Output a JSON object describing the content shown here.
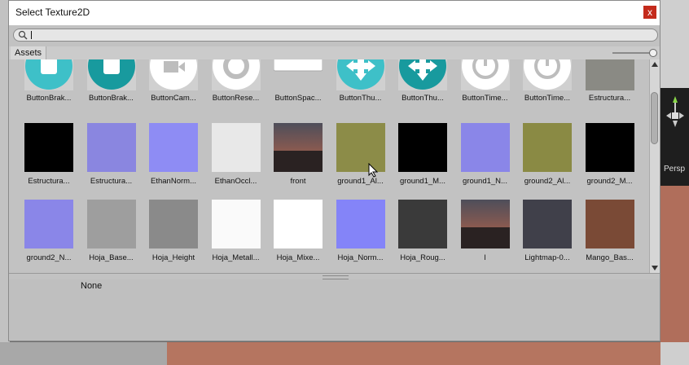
{
  "dialog": {
    "title": "Select Texture2D",
    "close_label": "x"
  },
  "search": {
    "value": "",
    "placeholder": ""
  },
  "tabs": {
    "assets": "Assets"
  },
  "details": {
    "selected_name": "None"
  },
  "background": {
    "perspective_label": "Persp"
  },
  "tiles": [
    {
      "label": "ButtonBrak...",
      "kind": "circle-square",
      "bg": "#3ec0c8"
    },
    {
      "label": "ButtonBrak...",
      "kind": "circle-square",
      "bg": "#189a9e"
    },
    {
      "label": "ButtonCam...",
      "kind": "camera",
      "bg": "#ffffff"
    },
    {
      "label": "ButtonRese...",
      "kind": "reset",
      "bg": "#ffffff"
    },
    {
      "label": "ButtonSpac...",
      "kind": "bar",
      "bg": "#ffffff"
    },
    {
      "label": "ButtonThu...",
      "kind": "arrows",
      "bg": "#3ec0c8"
    },
    {
      "label": "ButtonThu...",
      "kind": "arrows",
      "bg": "#189a9e"
    },
    {
      "label": "ButtonTime...",
      "kind": "timer",
      "bg": "#ffffff"
    },
    {
      "label": "ButtonTime...",
      "kind": "timer",
      "bg": "#ffffff"
    },
    {
      "label": "Estructura...",
      "kind": "tex",
      "bg": "#8a8a84"
    },
    {
      "label": "Estructura...",
      "kind": "tex",
      "bg": "#000000"
    },
    {
      "label": "Estructura...",
      "kind": "tex",
      "bg": "#8a86e0"
    },
    {
      "label": "EthanNorm...",
      "kind": "tex",
      "bg": "#8e8cf4"
    },
    {
      "label": "EthanOccl...",
      "kind": "tex",
      "bg": "#e8e8e8"
    },
    {
      "label": "front",
      "kind": "sky",
      "bg": "#604848"
    },
    {
      "label": "ground1_Al...",
      "kind": "tex",
      "bg": "#8c8c48"
    },
    {
      "label": "ground1_M...",
      "kind": "tex",
      "bg": "#000000"
    },
    {
      "label": "ground1_N...",
      "kind": "tex",
      "bg": "#8a86e8"
    },
    {
      "label": "ground2_Al...",
      "kind": "tex",
      "bg": "#8a8a44"
    },
    {
      "label": "ground2_M...",
      "kind": "tex",
      "bg": "#000000"
    },
    {
      "label": "ground2_N...",
      "kind": "tex",
      "bg": "#8a86e8"
    },
    {
      "label": "Hoja_Base...",
      "kind": "tex",
      "bg": "#9e9e9e"
    },
    {
      "label": "Hoja_Height",
      "kind": "tex",
      "bg": "#8a8a8a"
    },
    {
      "label": "Hoja_Metall...",
      "kind": "tex",
      "bg": "#fafafa"
    },
    {
      "label": "Hoja_Mixe...",
      "kind": "tex",
      "bg": "#ffffff"
    },
    {
      "label": "Hoja_Norm...",
      "kind": "tex",
      "bg": "#8484f8"
    },
    {
      "label": "Hoja_Roug...",
      "kind": "tex",
      "bg": "#3a3a3a"
    },
    {
      "label": "l",
      "kind": "sky",
      "bg": "#5a4444"
    },
    {
      "label": "Lightmap-0...",
      "kind": "tex",
      "bg": "#40404a"
    },
    {
      "label": "Mango_Bas...",
      "kind": "tex",
      "bg": "#7a4a36"
    }
  ]
}
